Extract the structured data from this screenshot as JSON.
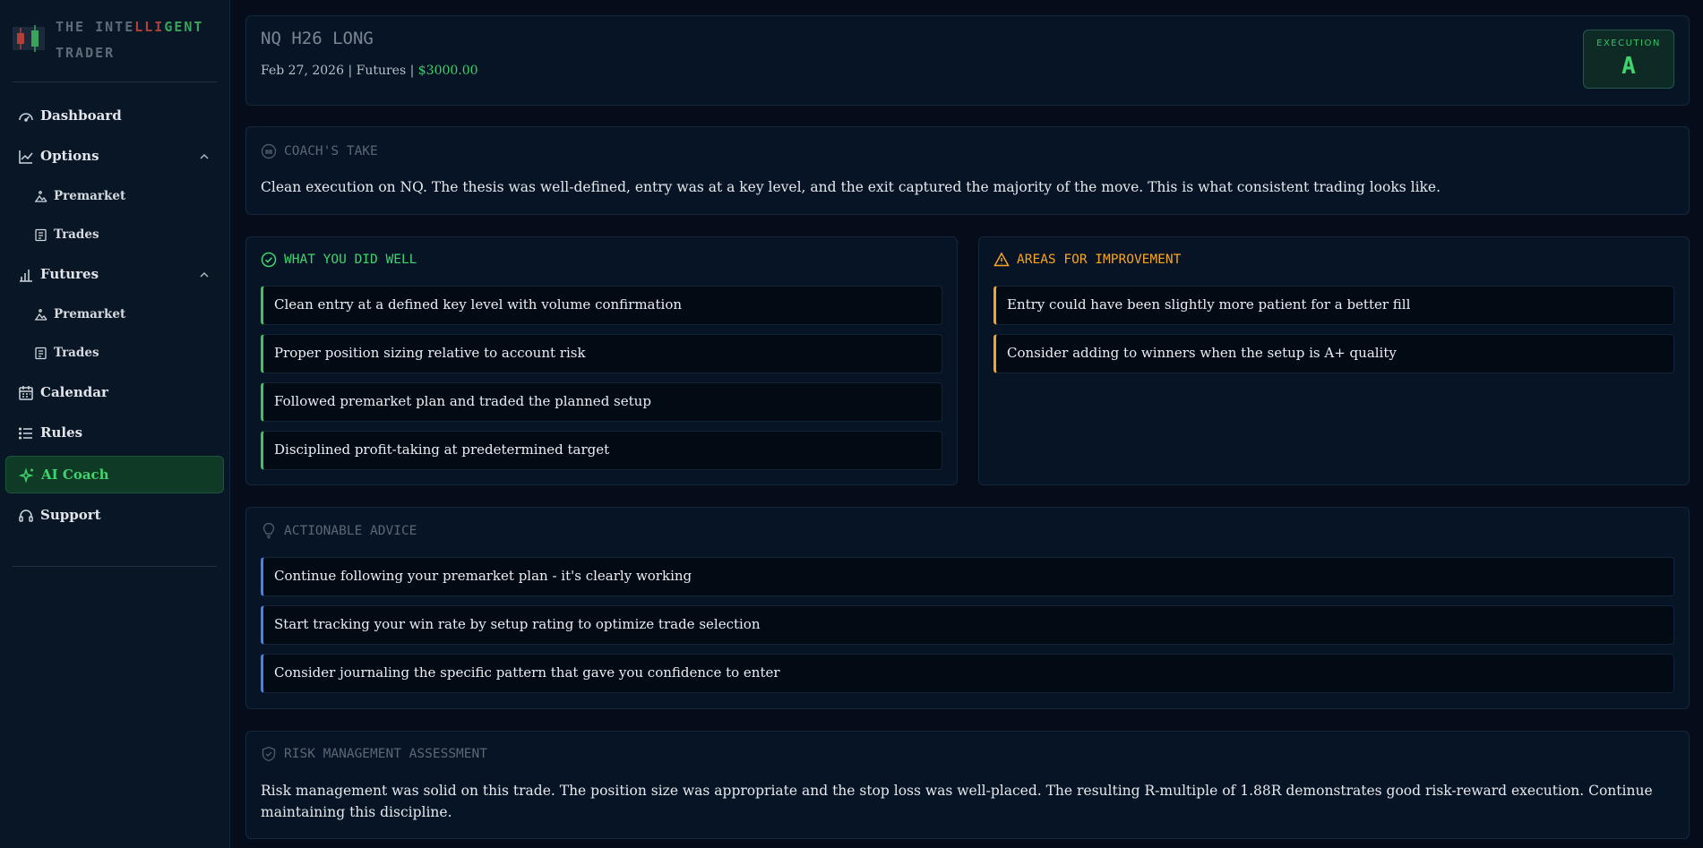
{
  "brand": {
    "line1_a": "THE INTE",
    "line1_b": "LLI",
    "line1_c": "GENT",
    "line2": "TRADER"
  },
  "sidebar": {
    "items": [
      {
        "label": "Dashboard",
        "icon": "gauge-icon"
      },
      {
        "label": "Options",
        "icon": "line-chart-icon",
        "expanded": true
      },
      {
        "label": "Premarket",
        "icon": "mountain-icon"
      },
      {
        "label": "Trades",
        "icon": "document-icon"
      },
      {
        "label": "Futures",
        "icon": "bar-chart-icon",
        "expanded": true
      },
      {
        "label": "Premarket",
        "icon": "mountain-icon"
      },
      {
        "label": "Trades",
        "icon": "document-icon"
      },
      {
        "label": "Calendar",
        "icon": "calendar-icon"
      },
      {
        "label": "Rules",
        "icon": "list-icon"
      },
      {
        "label": "AI Coach",
        "icon": "sparkles-icon",
        "active": true
      },
      {
        "label": "Support",
        "icon": "headset-icon"
      }
    ]
  },
  "trade": {
    "title": "NQ H26 LONG",
    "meta_prefix": "Feb 27, 2026 | Futures | ",
    "amount": "$3000.00",
    "grade_label": "EXECUTION",
    "grade_value": "A"
  },
  "coach": {
    "heading": "Coach's Take",
    "text": "Clean execution on NQ. The thesis was well-defined, entry was at a key level, and the exit captured the majority of the move. This is what consistent trading looks like."
  },
  "well": {
    "heading": "What You Did Well",
    "items": [
      "Clean entry at a defined key level with volume confirmation",
      "Proper position sizing relative to account risk",
      "Followed premarket plan and traded the planned setup",
      "Disciplined profit-taking at predetermined target"
    ]
  },
  "improve": {
    "heading": "Areas for Improvement",
    "items": [
      "Entry could have been slightly more patient for a better fill",
      "Consider adding to winners when the setup is A+ quality"
    ]
  },
  "advice": {
    "heading": "Actionable Advice",
    "items": [
      "Continue following your premarket plan - it's clearly working",
      "Start tracking your win rate by setup rating to optimize trade selection",
      "Consider journaling the specific pattern that gave you confidence to enter"
    ]
  },
  "risk": {
    "heading": "Risk Management Assessment",
    "text": "Risk management was solid on this trade. The position size was appropriate and the stop loss was well-placed. The resulting R-multiple of 1.88R demonstrates good risk-reward execution. Continue maintaining this discipline."
  },
  "colors": {
    "background": "#040d19",
    "sidebar": "#081626",
    "accent_green": "#3fd46d",
    "accent_amber": "#f5a524",
    "accent_blue": "#3f84f0"
  }
}
